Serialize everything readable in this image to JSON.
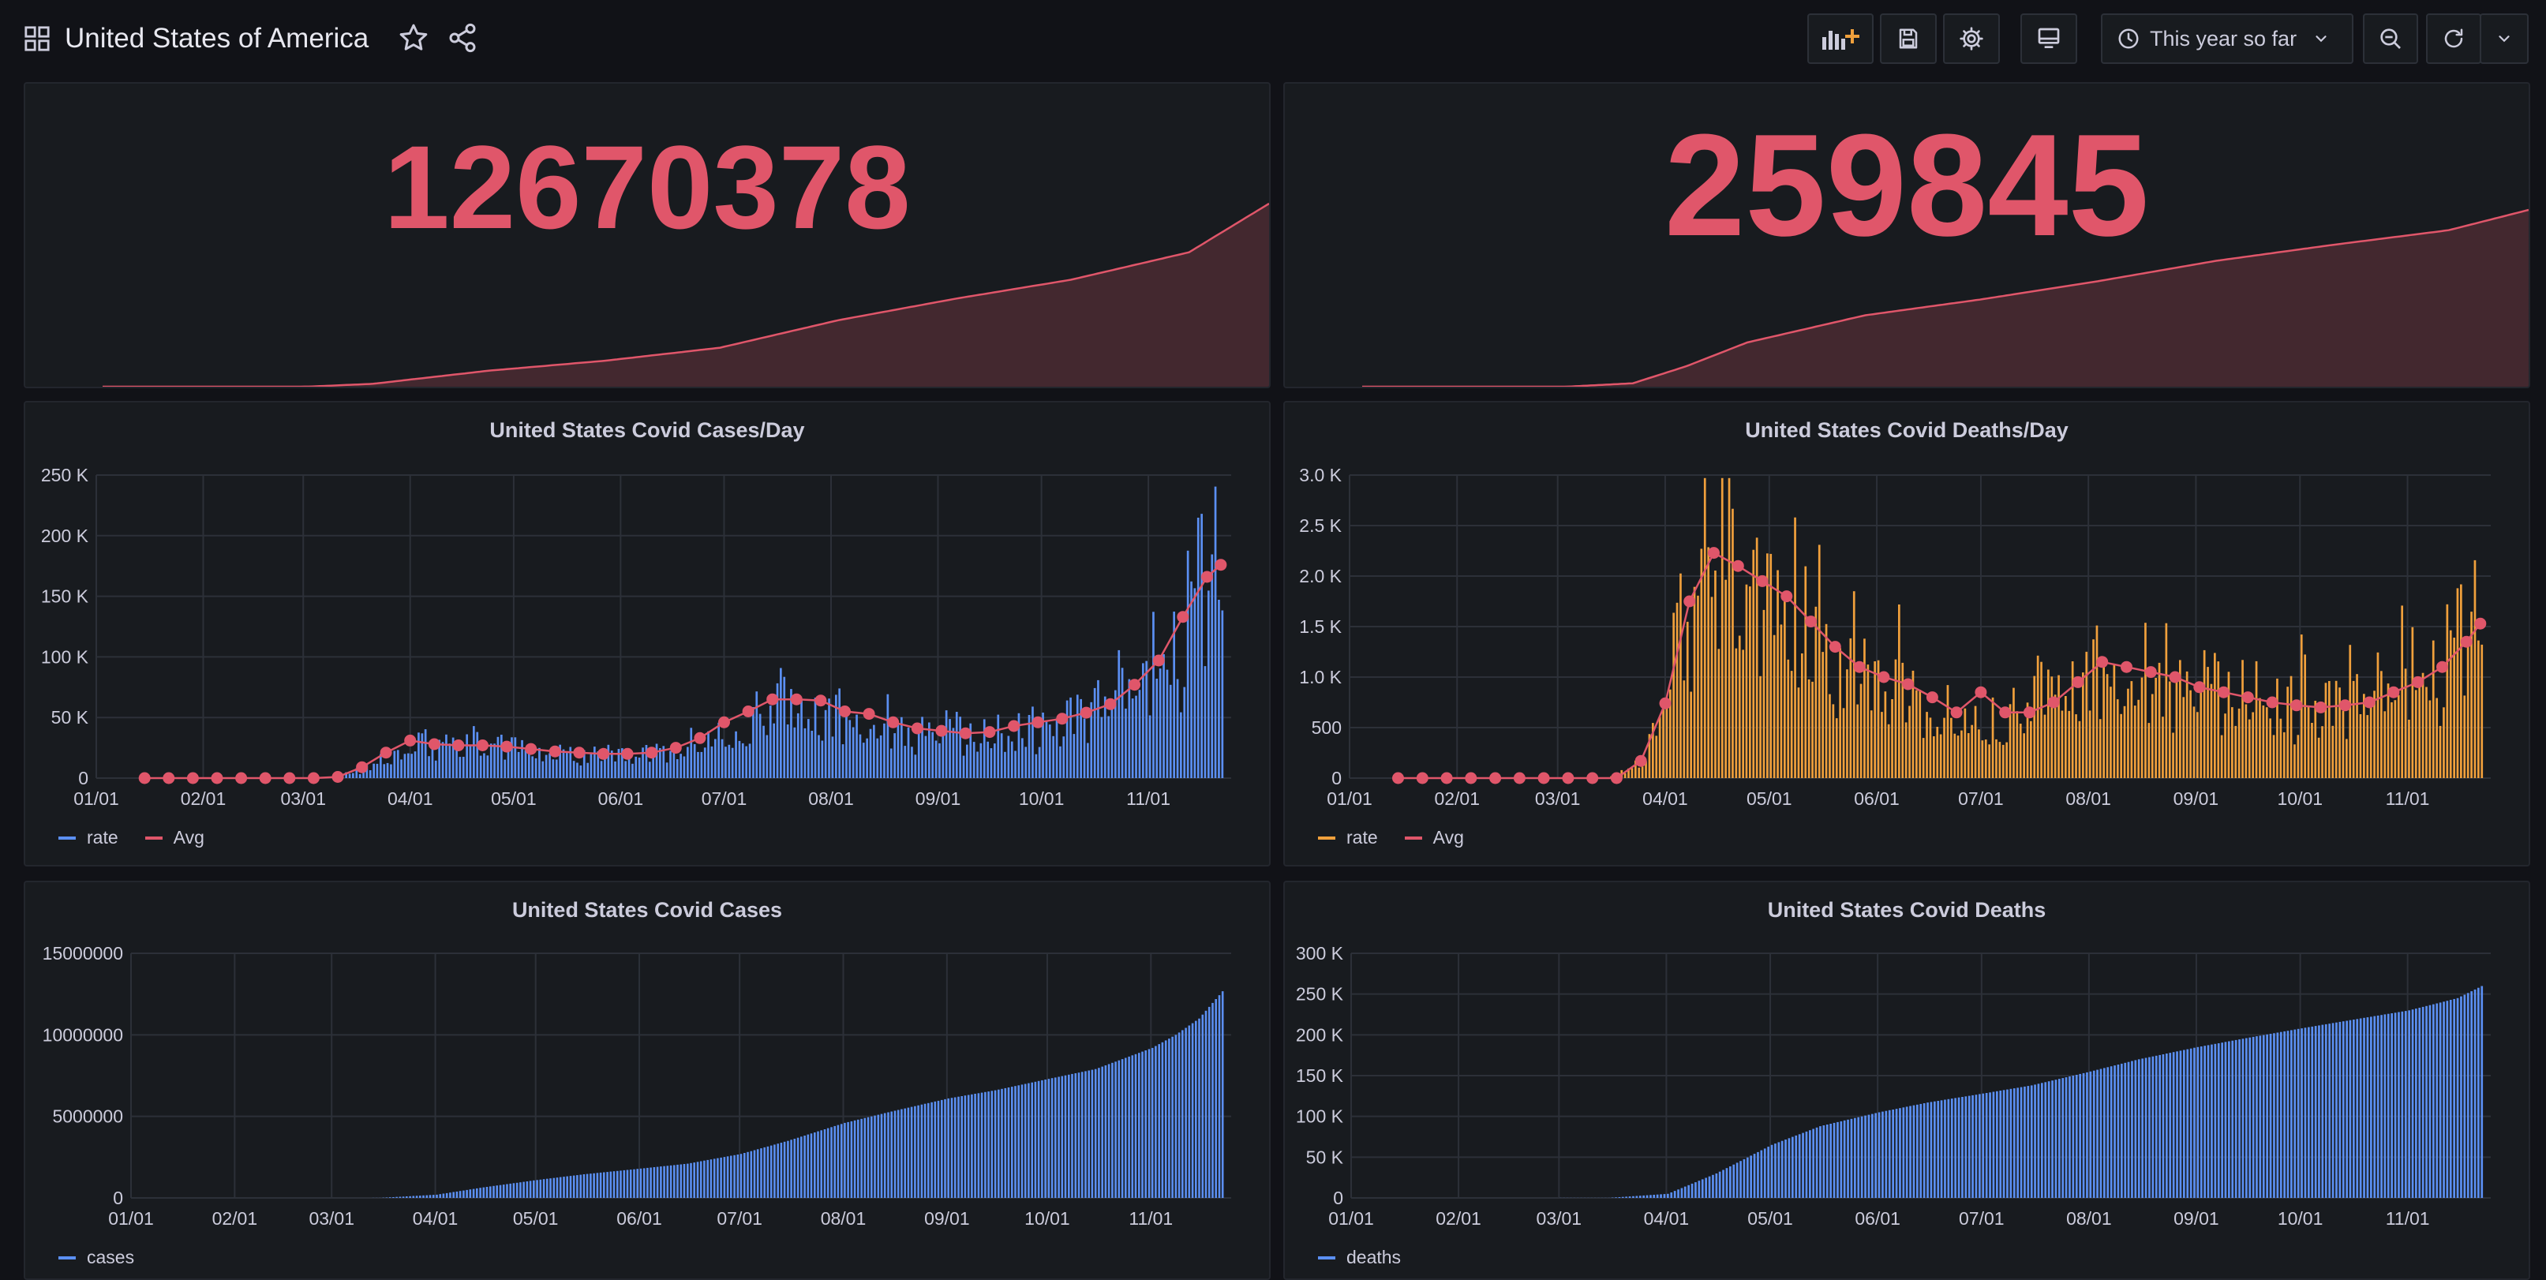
{
  "header": {
    "title": "United States of America",
    "time_range": "This year so far"
  },
  "colors": {
    "stat_red": "#e0566a",
    "blue": "#5b8ff2",
    "orange": "#f0a03c",
    "avg_red": "#e0566a",
    "grid": "#2c3038",
    "axis_text": "#ccccdc"
  },
  "panels": {
    "total_cases": {
      "value": "12670378"
    },
    "total_deaths": {
      "value": "259845"
    },
    "cases_per_day": {
      "title": "United States Covid Cases/Day",
      "legend": [
        "rate",
        "Avg"
      ]
    },
    "deaths_per_day": {
      "title": "United States Covid Deaths/Day",
      "legend": [
        "rate",
        "Avg"
      ]
    },
    "cases_total": {
      "title": "United States Covid Cases",
      "legend": [
        "cases"
      ]
    },
    "deaths_total": {
      "title": "United States Covid Deaths",
      "legend": [
        "deaths"
      ]
    }
  },
  "chart_data": [
    {
      "id": "total_cases_spark",
      "type": "area",
      "x": [
        "01/21",
        "02/01",
        "03/01",
        "03/15",
        "04/01",
        "05/01",
        "06/01",
        "07/01",
        "08/01",
        "09/01",
        "10/01",
        "11/01",
        "11/22"
      ],
      "values": [
        0,
        10,
        100,
        3000,
        200000,
        1100000,
        1800000,
        2700000,
        4600000,
        6100000,
        7400000,
        9300000,
        12670378
      ],
      "ylim": [
        0,
        12670378
      ]
    },
    {
      "id": "total_deaths_spark",
      "type": "area",
      "x": [
        "01/21",
        "02/01",
        "03/01",
        "03/15",
        "04/01",
        "04/15",
        "05/01",
        "06/01",
        "07/01",
        "08/01",
        "09/01",
        "10/01",
        "11/01",
        "11/22"
      ],
      "values": [
        0,
        0,
        1,
        60,
        5000,
        30000,
        65000,
        105000,
        128000,
        155000,
        185000,
        208000,
        230000,
        259845
      ],
      "ylim": [
        0,
        259845
      ]
    },
    {
      "id": "cases_per_day",
      "type": "bar",
      "title": "United States Covid Cases/Day",
      "x_ticks": [
        "01/01",
        "02/01",
        "03/01",
        "04/01",
        "05/01",
        "06/01",
        "07/01",
        "08/01",
        "09/01",
        "10/01",
        "11/01"
      ],
      "y_ticks": [
        "0",
        "50 K",
        "100 K",
        "150 K",
        "200 K",
        "250 K"
      ],
      "ylim": [
        0,
        250000
      ],
      "series": [
        {
          "name": "rate",
          "color": "#5b8ff2",
          "points": [
            [
              "01/01",
              0
            ],
            [
              "03/01",
              0
            ],
            [
              "03/10",
              1000
            ],
            [
              "03/20",
              10000
            ],
            [
              "04/01",
              25000
            ],
            [
              "04/10",
              32000
            ],
            [
              "04/25",
              30000
            ],
            [
              "05/10",
              24000
            ],
            [
              "05/25",
              21000
            ],
            [
              "06/10",
              20000
            ],
            [
              "06/25",
              32000
            ],
            [
              "07/05",
              48000
            ],
            [
              "07/15",
              64000
            ],
            [
              "07/25",
              66000
            ],
            [
              "08/05",
              56000
            ],
            [
              "08/15",
              50000
            ],
            [
              "08/25",
              43000
            ],
            [
              "09/05",
              40000
            ],
            [
              "09/15",
              35000
            ],
            [
              "09/25",
              42000
            ],
            [
              "10/05",
              45000
            ],
            [
              "10/15",
              57000
            ],
            [
              "10/25",
              78000
            ],
            [
              "11/01",
              92000
            ],
            [
              "11/08",
              120000
            ],
            [
              "11/15",
              160000
            ],
            [
              "11/20",
              180000
            ],
            [
              "11/22",
              178000
            ]
          ]
        },
        {
          "name": "Avg",
          "color": "#e0566a",
          "points": [
            [
              "01/15",
              0
            ],
            [
              "01/22",
              0
            ],
            [
              "01/29",
              0
            ],
            [
              "02/05",
              0
            ],
            [
              "02/12",
              0
            ],
            [
              "02/19",
              0
            ],
            [
              "02/26",
              0
            ],
            [
              "03/04",
              0
            ],
            [
              "03/11",
              1000
            ],
            [
              "03/18",
              9000
            ],
            [
              "03/25",
              21000
            ],
            [
              "04/01",
              31000
            ],
            [
              "04/08",
              28000
            ],
            [
              "04/15",
              27000
            ],
            [
              "04/22",
              27000
            ],
            [
              "04/29",
              26000
            ],
            [
              "05/06",
              24000
            ],
            [
              "05/13",
              22000
            ],
            [
              "05/20",
              21000
            ],
            [
              "05/27",
              20000
            ],
            [
              "06/03",
              20000
            ],
            [
              "06/10",
              21000
            ],
            [
              "06/17",
              25000
            ],
            [
              "06/24",
              33000
            ],
            [
              "07/01",
              46000
            ],
            [
              "07/08",
              55000
            ],
            [
              "07/15",
              65000
            ],
            [
              "07/22",
              65000
            ],
            [
              "07/29",
              64000
            ],
            [
              "08/05",
              55000
            ],
            [
              "08/12",
              53000
            ],
            [
              "08/19",
              46000
            ],
            [
              "08/26",
              41000
            ],
            [
              "09/02",
              39000
            ],
            [
              "09/09",
              37000
            ],
            [
              "09/16",
              38000
            ],
            [
              "09/23",
              43000
            ],
            [
              "09/30",
              46000
            ],
            [
              "10/07",
              49000
            ],
            [
              "10/14",
              54000
            ],
            [
              "10/21",
              61000
            ],
            [
              "10/28",
              77000
            ],
            [
              "11/04",
              97000
            ],
            [
              "11/11",
              133000
            ],
            [
              "11/18",
              166000
            ],
            [
              "11/22",
              176000
            ]
          ]
        }
      ]
    },
    {
      "id": "deaths_per_day",
      "type": "bar",
      "title": "United States Covid Deaths/Day",
      "x_ticks": [
        "01/01",
        "02/01",
        "03/01",
        "04/01",
        "05/01",
        "06/01",
        "07/01",
        "08/01",
        "09/01",
        "10/01",
        "11/01"
      ],
      "y_ticks": [
        "0",
        "500",
        "1.0 K",
        "1.5 K",
        "2.0 K",
        "2.5 K",
        "3.0 K"
      ],
      "ylim": [
        0,
        3000
      ],
      "series": [
        {
          "name": "rate",
          "color": "#f0a03c",
          "points": [
            [
              "01/01",
              0
            ],
            [
              "03/15",
              0
            ],
            [
              "03/25",
              150
            ],
            [
              "04/01",
              900
            ],
            [
              "04/08",
              1800
            ],
            [
              "04/15",
              2300
            ],
            [
              "04/25",
              2000
            ],
            [
              "05/05",
              1700
            ],
            [
              "05/15",
              1400
            ],
            [
              "05/25",
              1100
            ],
            [
              "06/05",
              900
            ],
            [
              "06/15",
              700
            ],
            [
              "06/25",
              600
            ],
            [
              "07/05",
              600
            ],
            [
              "07/15",
              800
            ],
            [
              "07/25",
              1100
            ],
            [
              "08/05",
              1200
            ],
            [
              "08/15",
              1100
            ],
            [
              "08/25",
              1000
            ],
            [
              "09/05",
              900
            ],
            [
              "09/15",
              850
            ],
            [
              "09/25",
              750
            ],
            [
              "10/05",
              700
            ],
            [
              "10/15",
              750
            ],
            [
              "10/25",
              900
            ],
            [
              "11/05",
              1100
            ],
            [
              "11/15",
              1400
            ],
            [
              "11/22",
              1700
            ]
          ]
        },
        {
          "name": "Avg",
          "color": "#e0566a",
          "points": [
            [
              "01/15",
              0
            ],
            [
              "01/22",
              0
            ],
            [
              "01/29",
              0
            ],
            [
              "02/05",
              0
            ],
            [
              "02/12",
              0
            ],
            [
              "02/19",
              0
            ],
            [
              "02/26",
              0
            ],
            [
              "03/04",
              0
            ],
            [
              "03/11",
              0
            ],
            [
              "03/18",
              0
            ],
            [
              "03/25",
              170
            ],
            [
              "04/01",
              740
            ],
            [
              "04/08",
              1750
            ],
            [
              "04/15",
              2230
            ],
            [
              "04/22",
              2100
            ],
            [
              "04/29",
              1950
            ],
            [
              "05/06",
              1800
            ],
            [
              "05/13",
              1550
            ],
            [
              "05/20",
              1300
            ],
            [
              "05/27",
              1100
            ],
            [
              "06/03",
              1000
            ],
            [
              "06/10",
              930
            ],
            [
              "06/17",
              800
            ],
            [
              "06/24",
              650
            ],
            [
              "07/01",
              850
            ],
            [
              "07/08",
              650
            ],
            [
              "07/15",
              650
            ],
            [
              "07/22",
              750
            ],
            [
              "07/29",
              950
            ],
            [
              "08/05",
              1150
            ],
            [
              "08/12",
              1100
            ],
            [
              "08/19",
              1050
            ],
            [
              "08/26",
              1000
            ],
            [
              "09/02",
              900
            ],
            [
              "09/09",
              850
            ],
            [
              "09/16",
              800
            ],
            [
              "09/23",
              750
            ],
            [
              "09/30",
              720
            ],
            [
              "10/07",
              700
            ],
            [
              "10/14",
              720
            ],
            [
              "10/21",
              750
            ],
            [
              "10/28",
              850
            ],
            [
              "11/04",
              950
            ],
            [
              "11/11",
              1100
            ],
            [
              "11/18",
              1350
            ],
            [
              "11/22",
              1530
            ]
          ]
        }
      ]
    },
    {
      "id": "cases_total",
      "type": "bar",
      "title": "United States Covid Cases",
      "x_ticks": [
        "01/01",
        "02/01",
        "03/01",
        "04/01",
        "05/01",
        "06/01",
        "07/01",
        "08/01",
        "09/01",
        "10/01",
        "11/01"
      ],
      "y_ticks": [
        "0",
        "5000000",
        "10000000",
        "15000000"
      ],
      "ylim": [
        0,
        15000000
      ],
      "series": [
        {
          "name": "cases",
          "color": "#5b8ff2",
          "points": [
            [
              "01/01",
              0
            ],
            [
              "03/01",
              100
            ],
            [
              "03/15",
              3000
            ],
            [
              "04/01",
              200000
            ],
            [
              "04/15",
              650000
            ],
            [
              "05/01",
              1100000
            ],
            [
              "05/15",
              1450000
            ],
            [
              "06/01",
              1800000
            ],
            [
              "06/15",
              2100000
            ],
            [
              "07/01",
              2700000
            ],
            [
              "07/15",
              3500000
            ],
            [
              "08/01",
              4600000
            ],
            [
              "08/15",
              5300000
            ],
            [
              "09/01",
              6100000
            ],
            [
              "09/15",
              6600000
            ],
            [
              "10/01",
              7300000
            ],
            [
              "10/15",
              7900000
            ],
            [
              "11/01",
              9200000
            ],
            [
              "11/08",
              10000000
            ],
            [
              "11/15",
              11000000
            ],
            [
              "11/22",
              12670378
            ]
          ]
        }
      ]
    },
    {
      "id": "deaths_total",
      "type": "bar",
      "title": "United States Covid Deaths",
      "x_ticks": [
        "01/01",
        "02/01",
        "03/01",
        "04/01",
        "05/01",
        "06/01",
        "07/01",
        "08/01",
        "09/01",
        "10/01",
        "11/01"
      ],
      "y_ticks": [
        "0",
        "50 K",
        "100 K",
        "150 K",
        "200 K",
        "250 K",
        "300 K"
      ],
      "ylim": [
        0,
        300000
      ],
      "series": [
        {
          "name": "deaths",
          "color": "#5b8ff2",
          "points": [
            [
              "01/01",
              0
            ],
            [
              "03/15",
              60
            ],
            [
              "04/01",
              5000
            ],
            [
              "04/15",
              30000
            ],
            [
              "05/01",
              65000
            ],
            [
              "05/15",
              88000
            ],
            [
              "06/01",
              105000
            ],
            [
              "06/15",
              117000
            ],
            [
              "07/01",
              128000
            ],
            [
              "07/15",
              138000
            ],
            [
              "08/01",
              155000
            ],
            [
              "08/15",
              170000
            ],
            [
              "09/01",
              185000
            ],
            [
              "09/15",
              196000
            ],
            [
              "10/01",
              208000
            ],
            [
              "10/15",
              218000
            ],
            [
              "11/01",
              230000
            ],
            [
              "11/15",
              245000
            ],
            [
              "11/22",
              259845
            ]
          ]
        }
      ]
    }
  ]
}
